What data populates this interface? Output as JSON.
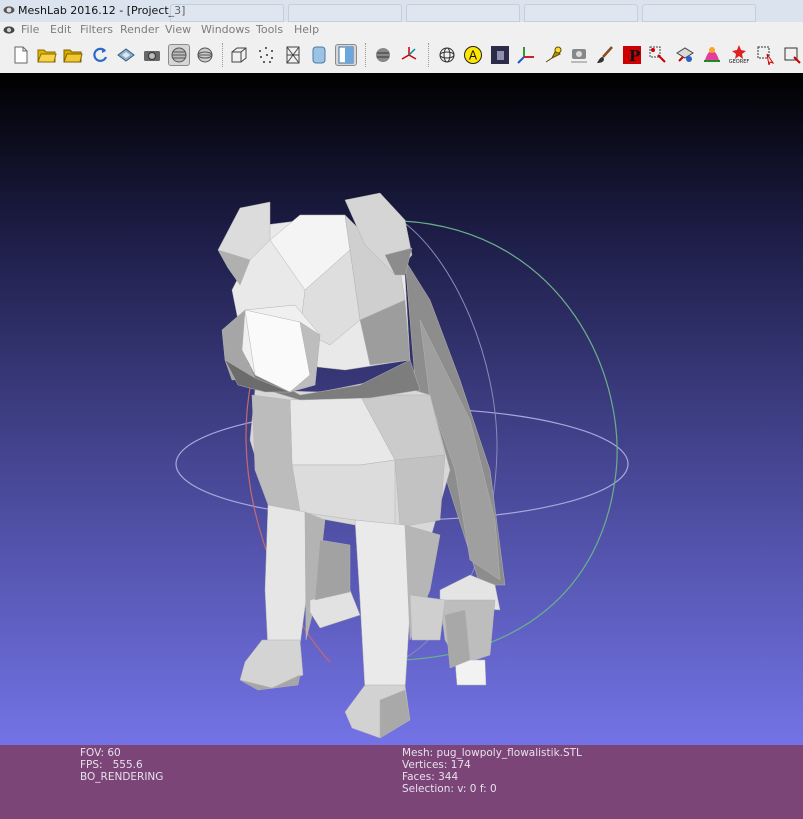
{
  "window": {
    "title": "MeshLab 2016.12 - [Project_3]"
  },
  "menu": [
    "File",
    "Edit",
    "Filters",
    "Render",
    "View",
    "Windows",
    "Tools",
    "Help"
  ],
  "toolbar": {
    "icons": [
      "new-document-icon",
      "open-folder-icon",
      "open-project-icon",
      "reload-icon",
      "export-mesh-icon",
      "snapshot-icon",
      "layers-icon",
      "render-mode-icon",
      "bounding-box-icon",
      "points-icon",
      "wireframe-icon",
      "flat-shading-icon",
      "smooth-shading-icon",
      "layer-stack-icon",
      "axis-icon",
      "trackball-icon",
      "annotation-icon",
      "texture-icon",
      "coordinate-frame-icon",
      "pickpoint-icon",
      "camera-icon",
      "paint-brush-icon",
      "pivot-icon",
      "select-faces-icon",
      "select-vertices-icon",
      "measure-icon",
      "georef-icon",
      "cursor-select-icon"
    ],
    "georef_label": "GEOREF"
  },
  "status": {
    "fov_label": "FOV:",
    "fov_value": "60",
    "fps_label": "FPS:",
    "fps_value": "555.6",
    "render_mode": "BO_RENDERING",
    "mesh_label": "Mesh:",
    "mesh_name": "pug_lowpoly_flowalistik.STL",
    "vertices_label": "Vertices:",
    "vertices_value": "174",
    "faces_label": "Faces:",
    "faces_value": "344",
    "selection_label": "Selection:",
    "selection_value": "v: 0 f: 0"
  },
  "colors": {
    "status_bar": "#7b4677",
    "viewport_top": "#000000",
    "viewport_bottom": "#7373e6",
    "mesh": "#c8c8c8"
  }
}
